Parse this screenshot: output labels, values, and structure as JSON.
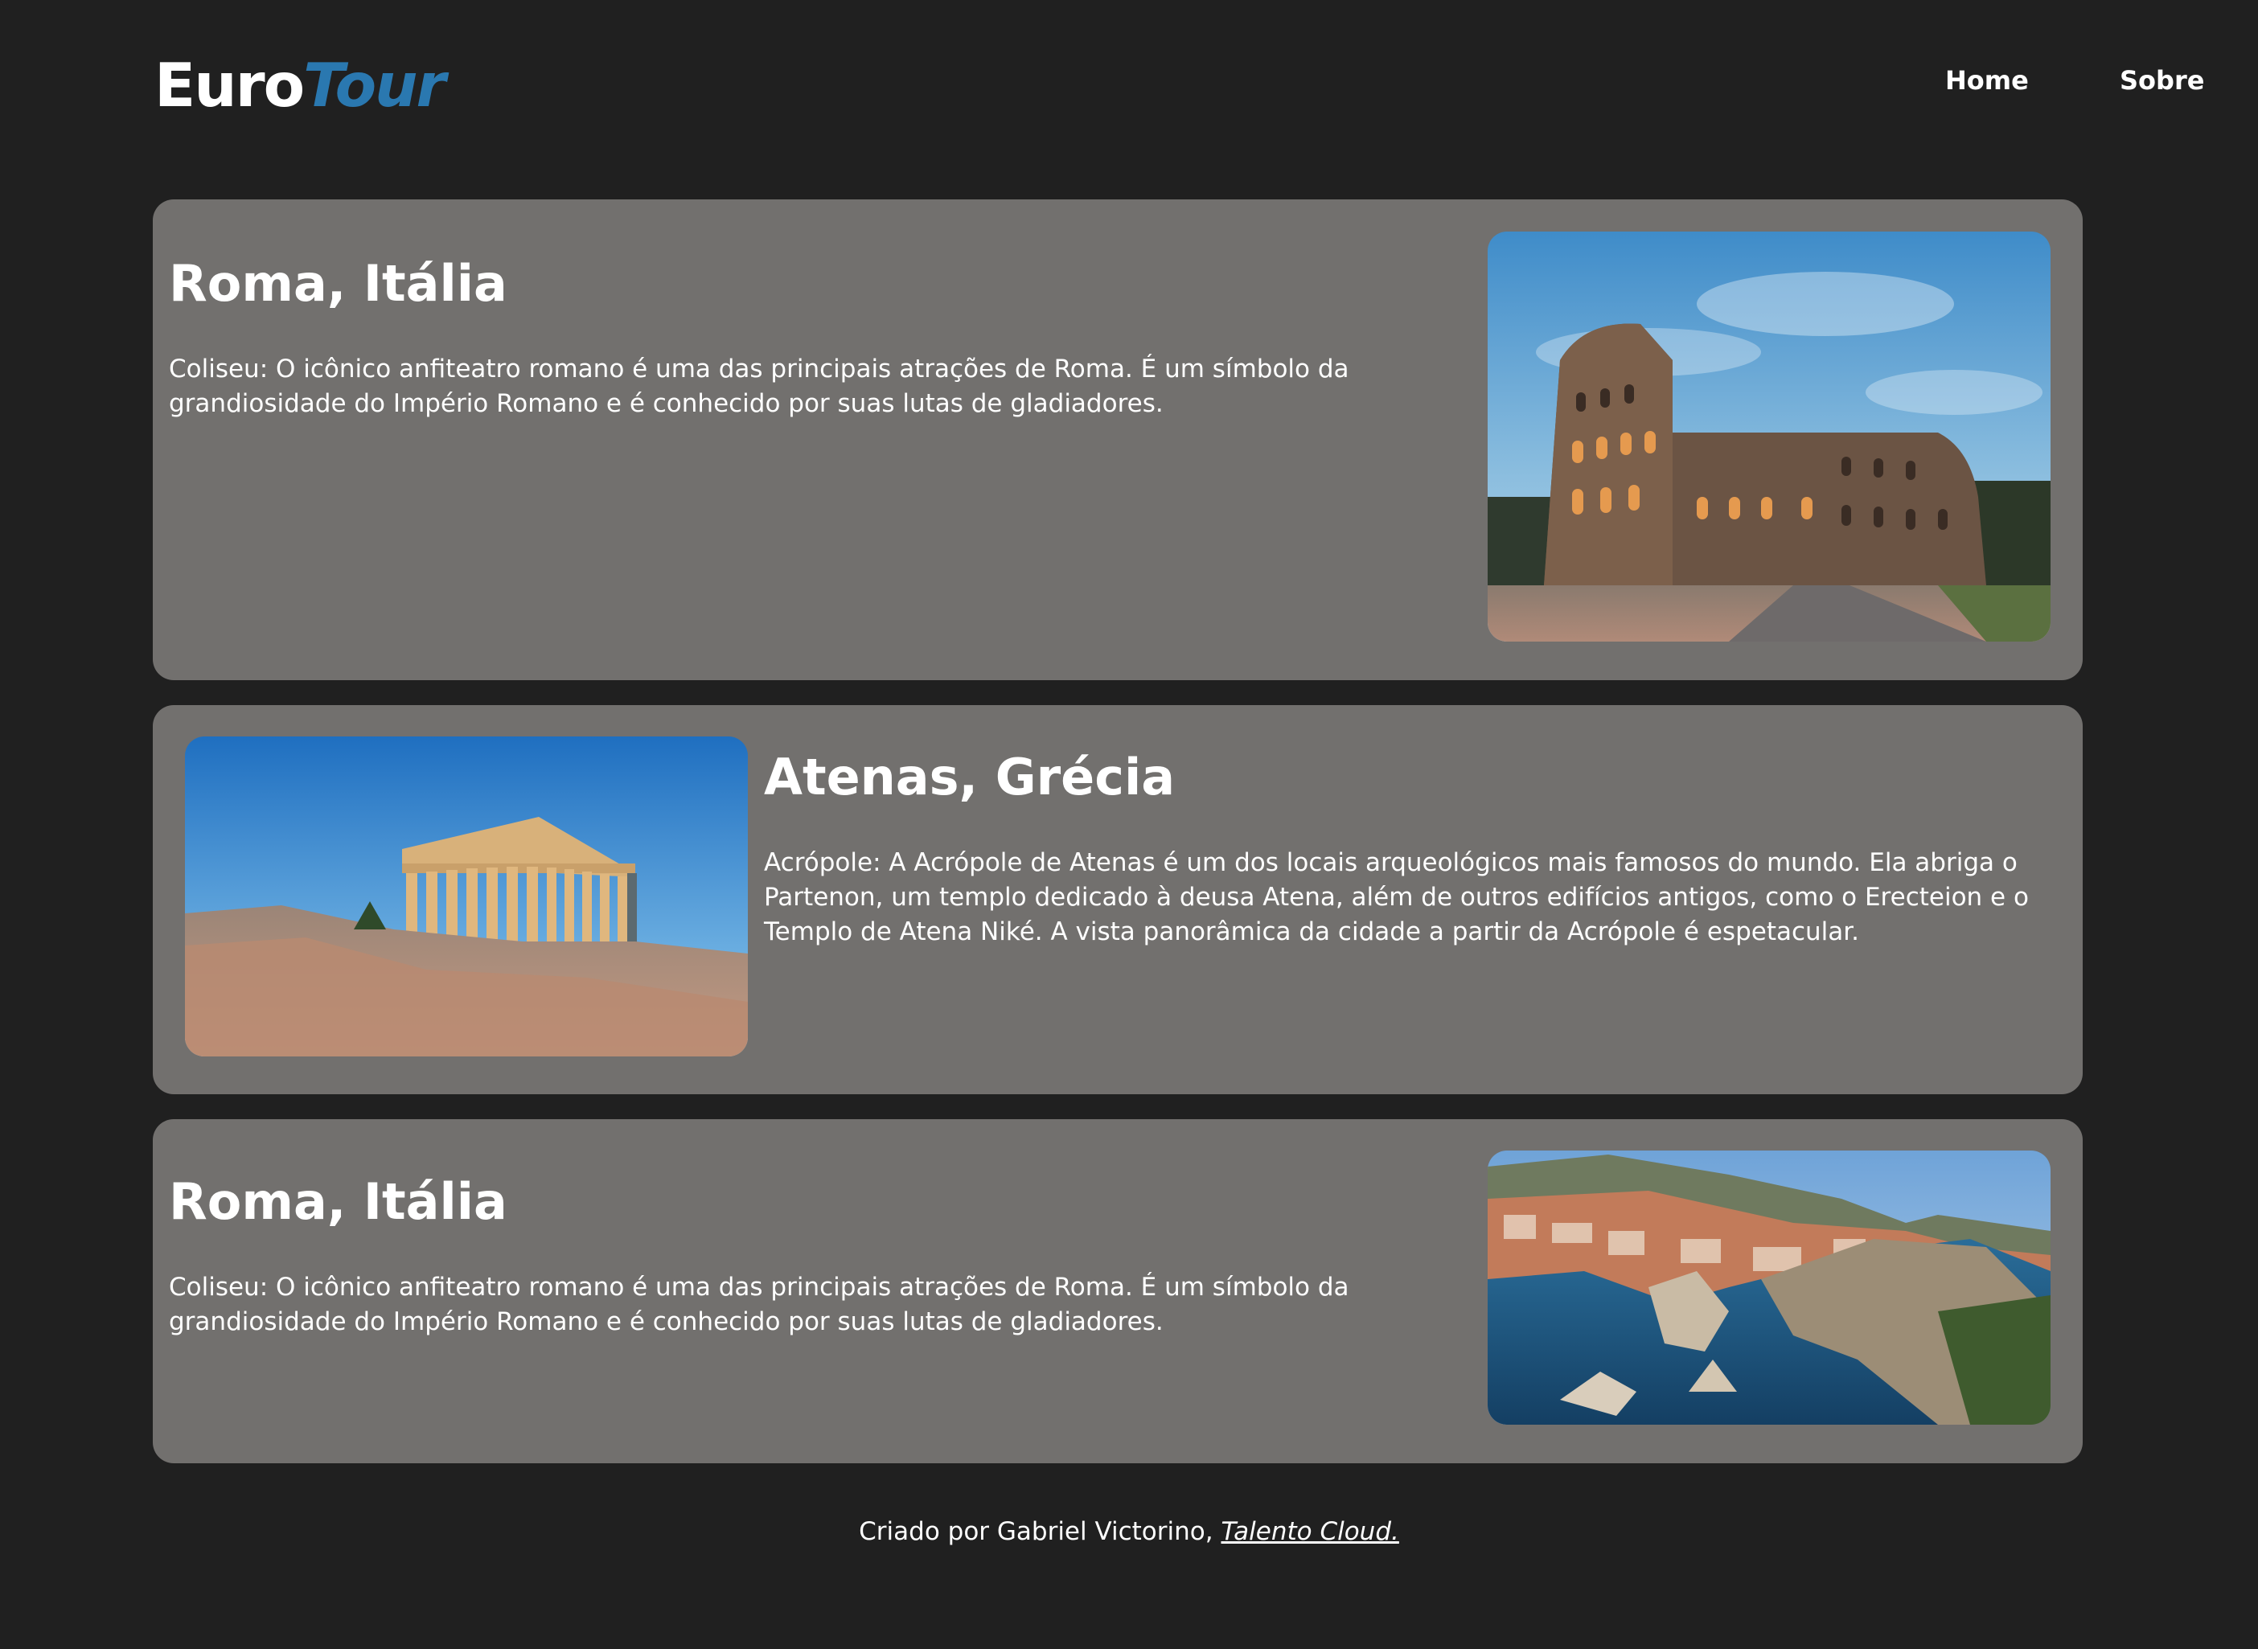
{
  "header": {
    "logo_part1": "Euro",
    "logo_part2": "Tour",
    "nav": [
      {
        "label": "Home"
      },
      {
        "label": "Sobre"
      }
    ]
  },
  "cards": [
    {
      "title": "Roma, Itália",
      "text": "Coliseu: O icônico anfiteatro romano é uma das principais atrações de Roma. É um símbolo da grandiosidade do Império Romano e é conhecido por suas lutas de gladiadores.",
      "image_subject": "colosseum"
    },
    {
      "title": "Atenas, Grécia",
      "text": "Acrópole: A Acrópole de Atenas é um dos locais arqueológicos mais famosos do mundo. Ela abriga o Partenon, um templo dedicado à deusa Atena, além de outros edifícios antigos, como o Erecteion e o Templo de Atena Niké. A vista panorâmica da cidade a partir da Acrópole é espetacular.",
      "image_subject": "parthenon"
    },
    {
      "title": "Roma, Itália",
      "text": "Coliseu: O icônico anfiteatro romano é uma das principais atrações de Roma. É um símbolo da grandiosidade do Império Romano e é conhecido por suas lutas de gladiadores.",
      "image_subject": "coastal-walled-city"
    }
  ],
  "footer": {
    "text": "Criado por Gabriel Victorino, ",
    "link_label": "Talento Cloud."
  },
  "colors": {
    "background": "#202020",
    "card": "#72706e",
    "accent": "#2a78b0"
  }
}
